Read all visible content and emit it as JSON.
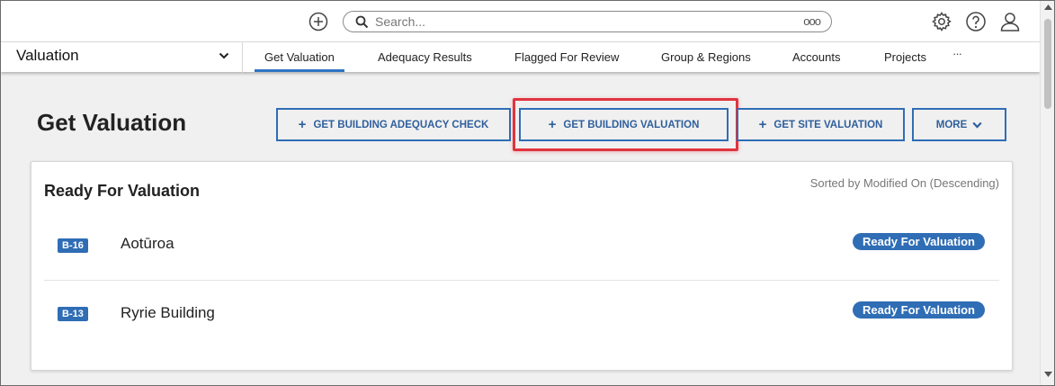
{
  "topbar": {
    "search_placeholder": "Search...",
    "search_options_icon": "ooo"
  },
  "navbar": {
    "module": "Valuation",
    "tabs": [
      {
        "label": "Get Valuation",
        "active": true
      },
      {
        "label": "Adequacy Results",
        "active": false
      },
      {
        "label": "Flagged For Review",
        "active": false
      },
      {
        "label": "Group & Regions",
        "active": false
      },
      {
        "label": "Accounts",
        "active": false
      },
      {
        "label": "Projects",
        "active": false
      }
    ],
    "more_icon": "···"
  },
  "header": {
    "title": "Get Valuation",
    "buttons": {
      "adequacy_check": "GET BUILDING ADEQUACY CHECK",
      "building_valuation": "GET BUILDING VALUATION",
      "site_valuation": "GET SITE VALUATION",
      "more": "MORE"
    }
  },
  "panel": {
    "title": "Ready For Valuation",
    "sort": "Sorted by Modified On (Descending)",
    "rows": [
      {
        "code": "B-16",
        "name": "Aotūroa",
        "status": "Ready For Valuation"
      },
      {
        "code": "B-13",
        "name": "Ryrie Building",
        "status": "Ready For Valuation"
      }
    ]
  },
  "colors": {
    "accent": "#2f6db5",
    "highlight": "#e0343f",
    "tab_underline": "#2f74c6"
  }
}
